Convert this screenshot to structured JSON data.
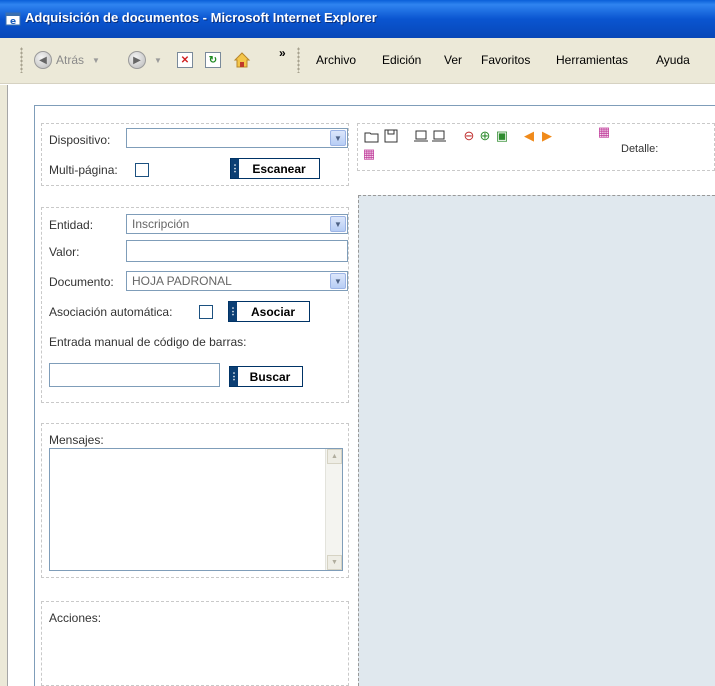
{
  "window": {
    "title": "Adquisición de documentos - Microsoft Internet Explorer"
  },
  "toolbar": {
    "back_label": "Atrás",
    "menu": [
      "Archivo",
      "Edición",
      "Ver",
      "Favoritos",
      "Herramientas",
      "Ayuda"
    ]
  },
  "scan_panel": {
    "device_label": "Dispositivo:",
    "device_value": "",
    "multipage_label": "Multi-página:",
    "scan_button": "Escanear"
  },
  "assoc_panel": {
    "entity_label": "Entidad:",
    "entity_value": "Inscripción",
    "value_label": "Valor:",
    "value_input": "",
    "document_label": "Documento:",
    "document_value": "HOJA PADRONAL",
    "auto_assoc_label": "Asociación automática:",
    "assoc_button": "Asociar",
    "barcode_label": "Entrada manual de código de barras:",
    "barcode_input": "",
    "search_button": "Buscar"
  },
  "messages_panel": {
    "label": "Mensajes:"
  },
  "actions_panel": {
    "label": "Acciones:"
  },
  "viewer_tools": {
    "detail_label": "Detalle:"
  },
  "colors": {
    "titlebar": "#0a55d0",
    "button_accent": "#0c3f74",
    "viewer_bg": "#e0e8ee"
  }
}
